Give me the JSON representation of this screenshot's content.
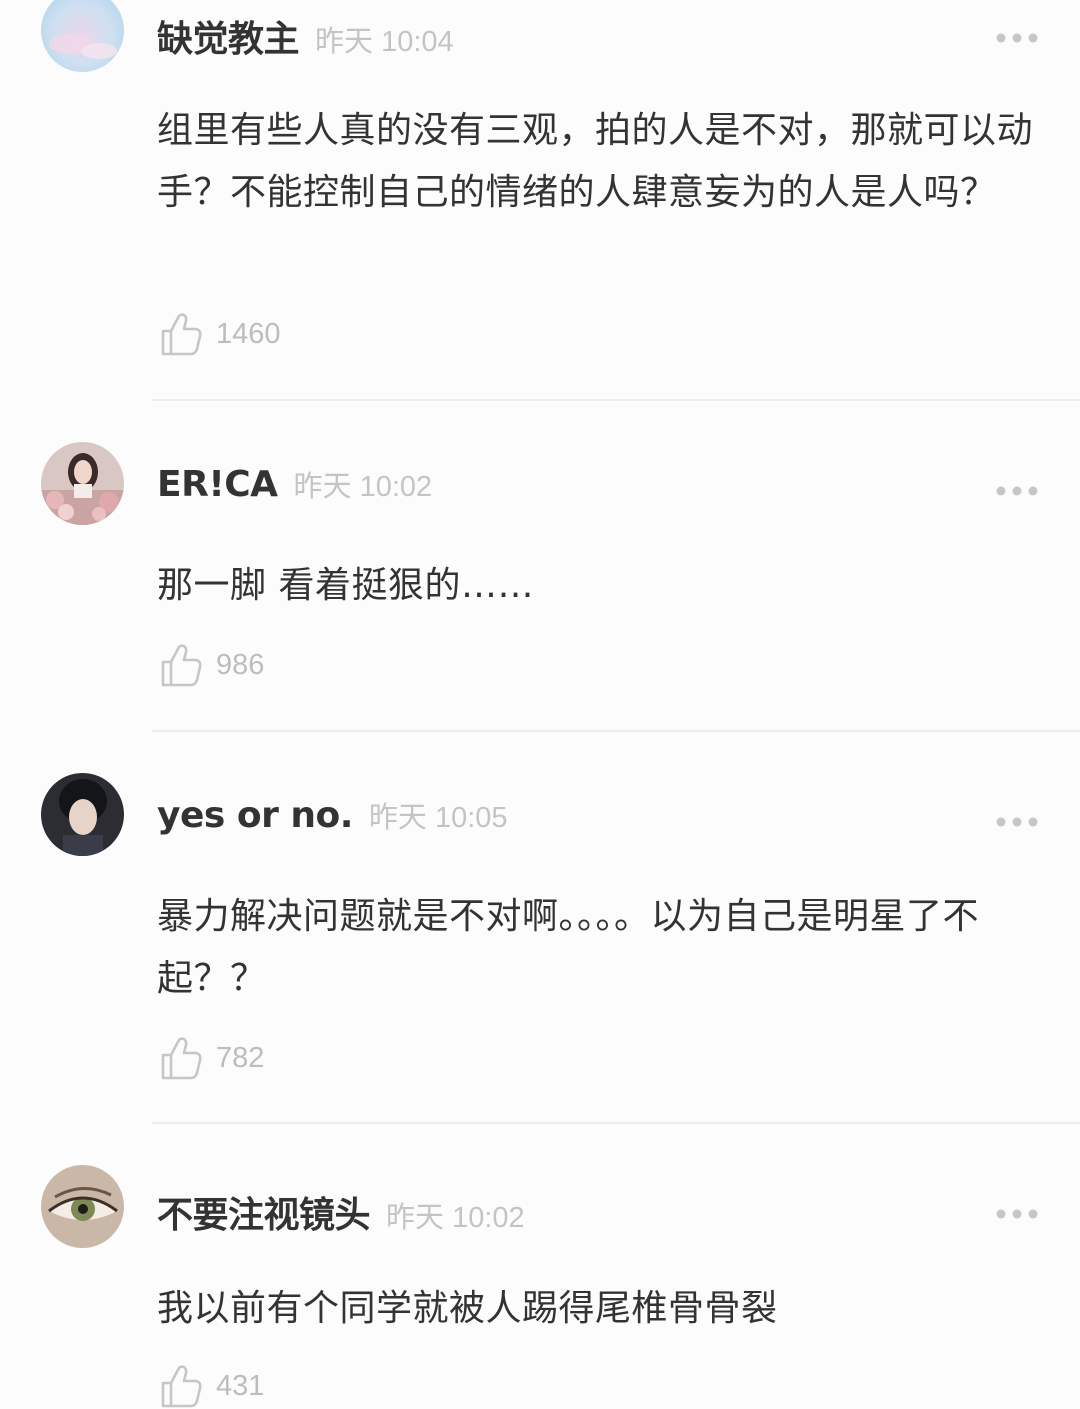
{
  "comments": [
    {
      "username": "缺觉教主",
      "time": "昨天 10:04",
      "text": "组里有些人真的没有三观，拍的人是不对，那就可以动手？不能控制自己的情绪的人肆意妄为的人是人吗？",
      "likes": "1460",
      "avatar_icon": "pastel-sky-avatar"
    },
    {
      "username": "ER!CA",
      "time": "昨天 10:02",
      "text": "那一脚 看着挺狠的……",
      "likes": "986",
      "avatar_icon": "girl-with-flowers-avatar"
    },
    {
      "username": "yes or no.",
      "time": "昨天 10:05",
      "text": "暴力解决问题就是不对啊。。。。以为自己是明星了不起？？",
      "likes": "782",
      "avatar_icon": "dark-hair-man-avatar"
    },
    {
      "username": "不要注视镜头",
      "time": "昨天 10:02",
      "text": "我以前有个同学就被人踢得尾椎骨骨裂",
      "likes": "431",
      "avatar_icon": "eye-closeup-avatar"
    }
  ],
  "colors": {
    "background": "#fdfcfd",
    "username": "#333333",
    "timestamp": "#c4c4c4",
    "icon_gray": "#c6c6c6",
    "divider": "#ececec"
  }
}
